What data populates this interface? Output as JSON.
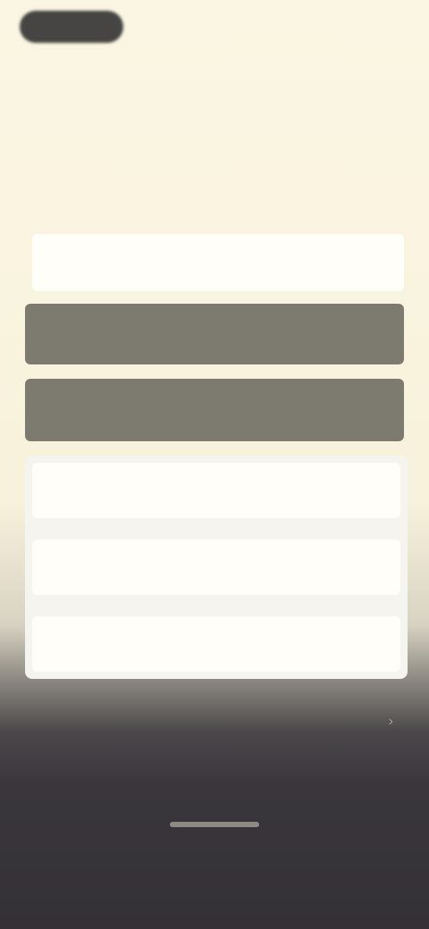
{
  "header": {
    "back_label": "",
    "subtitle": "",
    "title": ""
  },
  "options": [
    {
      "label": ""
    },
    {
      "label": ""
    },
    {
      "label": ""
    }
  ],
  "list": [
    {
      "label": ""
    },
    {
      "label": ""
    },
    {
      "label": ""
    }
  ],
  "footer": {
    "label": "",
    "chevron_icon": "chevron-right-icon"
  },
  "colors": {
    "background_top": "#fbf6e3",
    "background_bottom": "#333036",
    "card_white": "#fffef8",
    "card_selected": "#7d7b70",
    "back_pill": "#464543"
  }
}
